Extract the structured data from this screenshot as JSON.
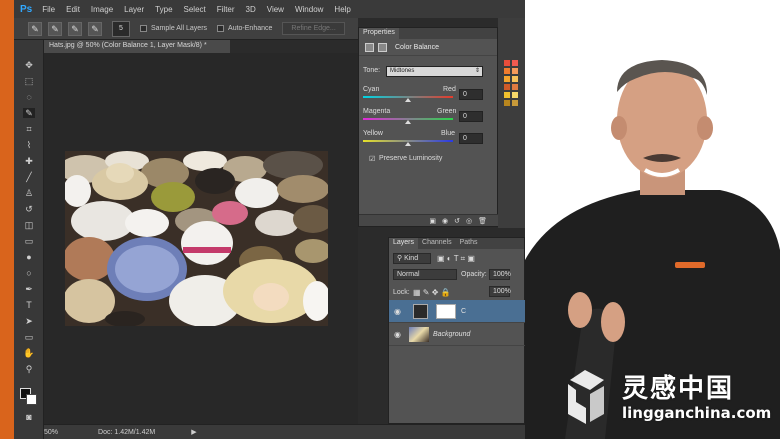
{
  "app": {
    "logo": "Ps",
    "menu": [
      "File",
      "Edit",
      "Image",
      "Layer",
      "Type",
      "Select",
      "Filter",
      "3D",
      "View",
      "Window",
      "Help"
    ]
  },
  "options_bar": {
    "brush_size": "5",
    "sample_all_layers": "Sample All Layers",
    "auto_enhance": "Auto-Enhance",
    "refine_edge": "Refine Edge..."
  },
  "document": {
    "tab_title": "Hats.jpg @ 50% (Color Balance 1, Layer Mask/8) *",
    "zoom": "50%",
    "doc_info": "Doc: 1.42M/1.42M"
  },
  "properties": {
    "tab": "Properties",
    "title": "Color Balance",
    "tone_label": "Tone:",
    "tone_value": "Midtones",
    "sliders": [
      {
        "left": "Cyan",
        "right": "Red",
        "value": "0",
        "level": 0
      },
      {
        "left": "Magenta",
        "right": "Green",
        "value": "0",
        "level": 0
      },
      {
        "left": "Yellow",
        "right": "Blue",
        "value": "0",
        "level": 0
      }
    ],
    "preserve_luminosity": "Preserve Luminosity"
  },
  "layers": {
    "tabs": [
      "Layers",
      "Channels",
      "Paths"
    ],
    "filter_kind": "Kind",
    "blend_mode": "Normal",
    "opacity_label": "Opacity:",
    "opacity_value": "100%",
    "fill_value": "100%",
    "lock_label": "Lock:",
    "items": [
      {
        "name": "C"
      },
      {
        "name": "Background"
      }
    ]
  },
  "watermark": {
    "cn_text": "灵感中国",
    "url": "lingganchina.com"
  },
  "colors": {
    "accent": "#d9641c",
    "ps_blue": "#31a8ff",
    "selection_blue": "#4a6f93"
  }
}
